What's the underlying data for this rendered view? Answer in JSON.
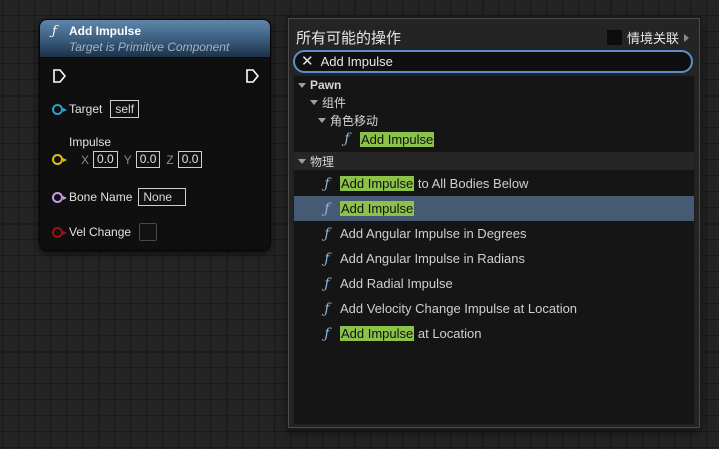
{
  "node": {
    "title": "Add Impulse",
    "subtitle": "Target is Primitive Component",
    "fn_icon": "ƒ",
    "pins": {
      "target_label": "Target",
      "target_value": "self",
      "impulse_label": "Impulse",
      "x_label": "X",
      "x_value": "0.0",
      "y_label": "Y",
      "y_value": "0.0",
      "z_label": "Z",
      "z_value": "0.0",
      "bone_label": "Bone Name",
      "bone_value": "None",
      "vel_label": "Vel Change"
    },
    "colors": {
      "target_pin": "#2f9fd0",
      "impulse_pin": "#e0c300",
      "bone_pin": "#c69ae8",
      "vel_pin": "#8a0d0d",
      "header": "#3f6487"
    }
  },
  "menu": {
    "title": "所有可能的操作",
    "context_label": "情境关联",
    "search_value": "Add Impulse",
    "tree": {
      "pawn": "Pawn",
      "components": "组件",
      "char_move": "角色移动",
      "physics": "物理"
    },
    "items": [
      {
        "hl": "Add Impulse",
        "rest": "",
        "icon": "function-icon"
      },
      {
        "hl": "Add Impulse",
        "rest": " to All Bodies Below",
        "icon": "function-icon"
      },
      {
        "hl": "Add Impulse",
        "rest": "",
        "icon": "function-icon",
        "selected": true
      },
      {
        "hl": "",
        "rest": "Add Angular Impulse in Degrees",
        "icon": "function-icon"
      },
      {
        "hl": "",
        "rest": "Add Angular Impulse in Radians",
        "icon": "function-icon"
      },
      {
        "hl": "",
        "rest": "Add Radial Impulse",
        "icon": "function-icon"
      },
      {
        "hl": "",
        "rest": "Add Velocity Change Impulse at Location",
        "icon": "function-icon"
      },
      {
        "hl": "Add Impulse",
        "rest": " at Location",
        "icon": "function-icon"
      }
    ],
    "colors": {
      "highlight": "#8bc24a",
      "selected_row": "#465a74",
      "search_border": "#5b8fc9"
    }
  }
}
